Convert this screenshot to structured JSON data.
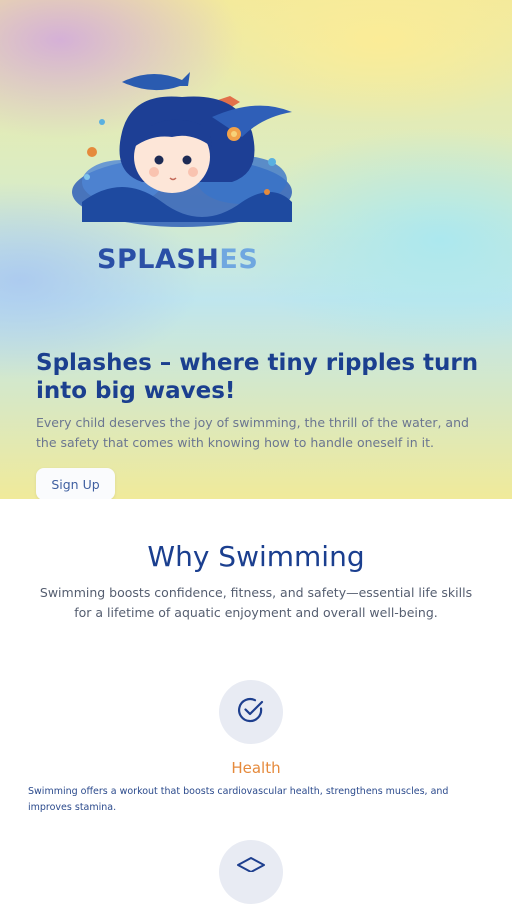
{
  "logo": {
    "text_main": "SPLASH",
    "text_accent": "ES"
  },
  "hero": {
    "title": "Splashes – where tiny ripples turn into big waves!",
    "subtitle": "Every child deserves the joy of swimming, the thrill of the water, and the safety that comes with knowing how to handle oneself in it.",
    "signup_label": "Sign Up"
  },
  "why": {
    "title": "Why Swimming",
    "subtitle": "Swimming boosts confidence, fitness, and safety—essential life skills for a lifetime of aquatic enjoyment and overall well-being."
  },
  "features": [
    {
      "icon": "check-circle-icon",
      "title": "Health",
      "text": "Swimming offers a workout that boosts cardiovascular health, strengthens muscles, and improves stamina."
    },
    {
      "icon": "graduation-cap-icon"
    }
  ],
  "colors": {
    "brand": "#1b3f8f",
    "accent": "#e58a3c",
    "icon_bg": "#e8ebf3"
  }
}
